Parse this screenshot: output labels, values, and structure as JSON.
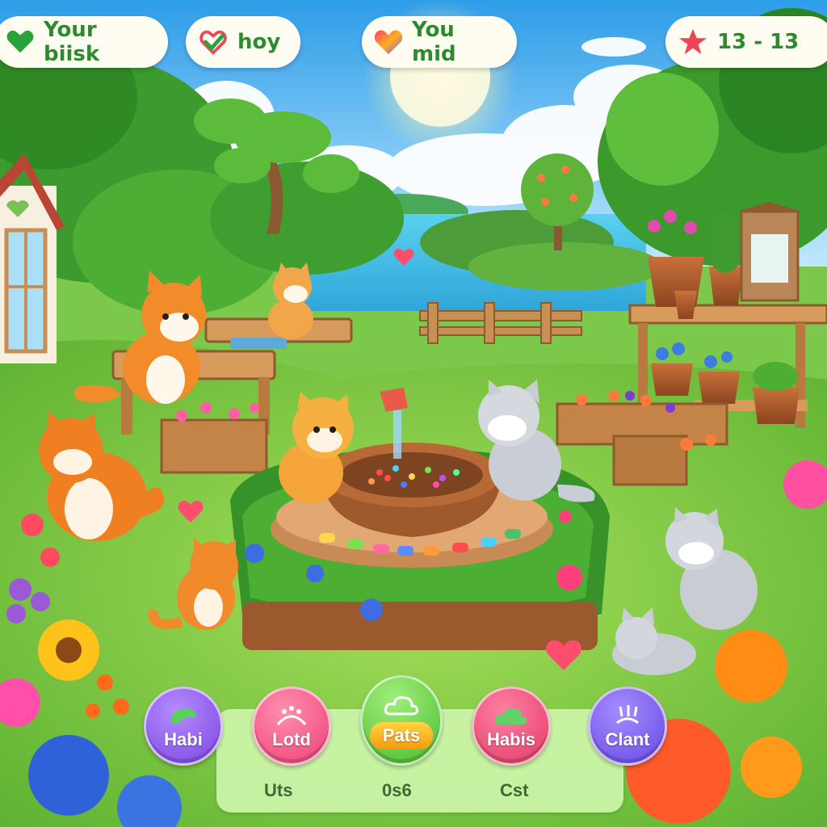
{
  "hud": {
    "pills": [
      {
        "label": "Your biisk",
        "icon": "green-heart-icon"
      },
      {
        "label": "hoy",
        "icon": "heart-check-icon"
      },
      {
        "label": "You mid",
        "icon": "rainbow-heart-icon"
      },
      {
        "label": "13 - 13",
        "icon": "red-star-icon"
      }
    ]
  },
  "actions": {
    "buttons": [
      {
        "label": "Habi",
        "icon": "leaf-icon",
        "color": "#7a45e0"
      },
      {
        "label": "Lotd",
        "icon": "paw-icon",
        "color": "#ee3f72"
      },
      {
        "label": "Pats",
        "icon": "cloud-leaf-icon",
        "color": "#4cba2e"
      },
      {
        "label": "Habis",
        "icon": "cloud-icon",
        "color": "#e23b66"
      },
      {
        "label": "Clant",
        "icon": "sparkle-icon",
        "color": "#6747e4"
      }
    ],
    "sub_labels": [
      "Uts",
      "0s6",
      "Cst"
    ]
  },
  "colors": {
    "sky": "#4fb8f0",
    "grass": "#7cc84a",
    "hud_text": "#2e8a2e"
  }
}
